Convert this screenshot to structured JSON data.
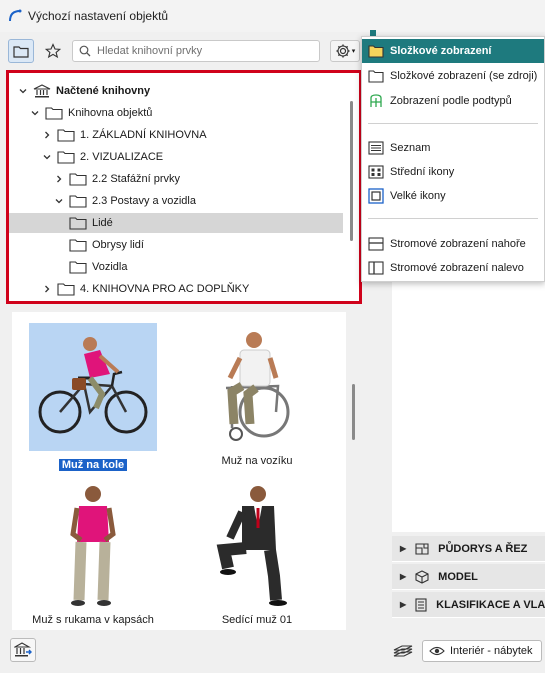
{
  "window": {
    "title": "Výchozí nastavení objektů"
  },
  "search": {
    "placeholder": "Hledat knihovní prvky"
  },
  "tree": {
    "items": [
      {
        "label": "Načtené knihovny",
        "bold": true,
        "expanded": true
      },
      {
        "label": "Knihovna objektů",
        "expanded": true
      },
      {
        "label": "1. ZÁKLADNÍ KNIHOVNA",
        "expanded": false
      },
      {
        "label": "2. VIZUALIZACE",
        "expanded": true
      },
      {
        "label": "2.2 Stafážní prvky",
        "expanded": false
      },
      {
        "label": "2.3 Postavy a vozidla",
        "expanded": true
      },
      {
        "label": "Lidé",
        "selected": true
      },
      {
        "label": "Obrysy lidí"
      },
      {
        "label": "Vozidla"
      },
      {
        "label": "4. KNIHOVNA PRO AC DOPLŇKY",
        "expanded": false
      }
    ]
  },
  "items": [
    {
      "caption": "Muž na kole",
      "selected": true
    },
    {
      "caption": "Muž na vozíku"
    },
    {
      "caption": "Muž s rukama v kapsách"
    },
    {
      "caption": "Sedící muž 01"
    }
  ],
  "menu": {
    "items": [
      {
        "label": "Složkové zobrazení",
        "icon": "folder-icon",
        "active": true
      },
      {
        "label": "Složkové zobrazení (se zdroji)",
        "icon": "folder-icon"
      },
      {
        "label": "Zobrazení podle podtypů",
        "icon": "subtype-icon"
      },
      {
        "label": "Seznam",
        "icon": "list-icon"
      },
      {
        "label": "Střední ikony",
        "icon": "medium-icons-icon"
      },
      {
        "label": "Velké ikony",
        "icon": "large-icons-icon"
      },
      {
        "label": "Stromové zobrazení nahoře",
        "icon": "tree-top-icon"
      },
      {
        "label": "Stromové zobrazení nalevo",
        "icon": "tree-left-icon"
      }
    ]
  },
  "right_sections": [
    {
      "label": "PŮDORYS A ŘEZ",
      "icon": "floorplan-icon"
    },
    {
      "label": "MODEL",
      "icon": "cube-icon"
    },
    {
      "label": "KLASIFIKACE A VLASTNOSTI",
      "icon": "document-icon"
    }
  ],
  "layer": {
    "label": "Interiér - nábytek"
  },
  "colors": {
    "accent": "#1e7a7e",
    "highlight_border": "#d0021b",
    "selection": "#1b62c8"
  }
}
